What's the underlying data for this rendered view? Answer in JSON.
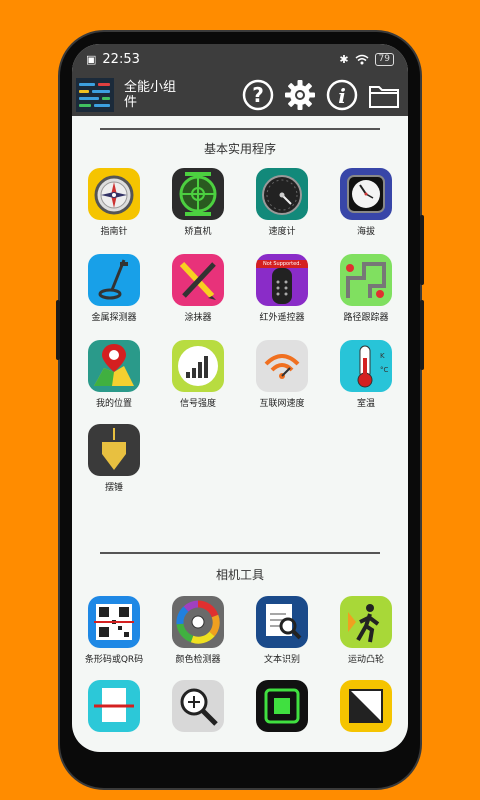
{
  "status_bar": {
    "time": "22:53",
    "battery": "79"
  },
  "app_bar": {
    "title": "全能小组件"
  },
  "sections": [
    {
      "title": "基本实用程序",
      "tools": [
        {
          "label": "指南针",
          "icon": "compass-icon"
        },
        {
          "label": "矫直机",
          "icon": "level-icon"
        },
        {
          "label": "速度计",
          "icon": "speedometer-icon"
        },
        {
          "label": "海拔",
          "icon": "altimeter-icon"
        },
        {
          "label": "金属探测器",
          "icon": "metal-detector-icon"
        },
        {
          "label": "涂抹器",
          "icon": "sketch-pencil-icon"
        },
        {
          "label": "红外遥控器",
          "icon": "ir-remote-icon",
          "badge": "Not Supported."
        },
        {
          "label": "路径跟踪器",
          "icon": "route-map-icon"
        },
        {
          "label": "我的位置",
          "icon": "location-map-icon"
        },
        {
          "label": "信号强度",
          "icon": "signal-bars-icon"
        },
        {
          "label": "互联网速度",
          "icon": "wifi-speed-icon"
        },
        {
          "label": "室温",
          "icon": "thermometer-icon"
        },
        {
          "label": "摆锤",
          "icon": "pendulum-icon"
        }
      ]
    },
    {
      "title": "相机工具",
      "tools": [
        {
          "label": "条形码或QR码",
          "icon": "qr-code-icon"
        },
        {
          "label": "颜色检测器",
          "icon": "color-wheel-icon"
        },
        {
          "label": "文本识别",
          "icon": "text-scan-icon"
        },
        {
          "label": "运动凸轮",
          "icon": "motion-cam-icon"
        },
        {
          "label": "",
          "icon": "document-scanner-icon"
        },
        {
          "label": "",
          "icon": "magnifier-icon"
        },
        {
          "label": "",
          "icon": "mirror-icon"
        },
        {
          "label": "",
          "icon": "split-image-icon"
        }
      ]
    }
  ],
  "colors": {
    "background": "#FF8C00",
    "bar": "#3d3d3d"
  }
}
